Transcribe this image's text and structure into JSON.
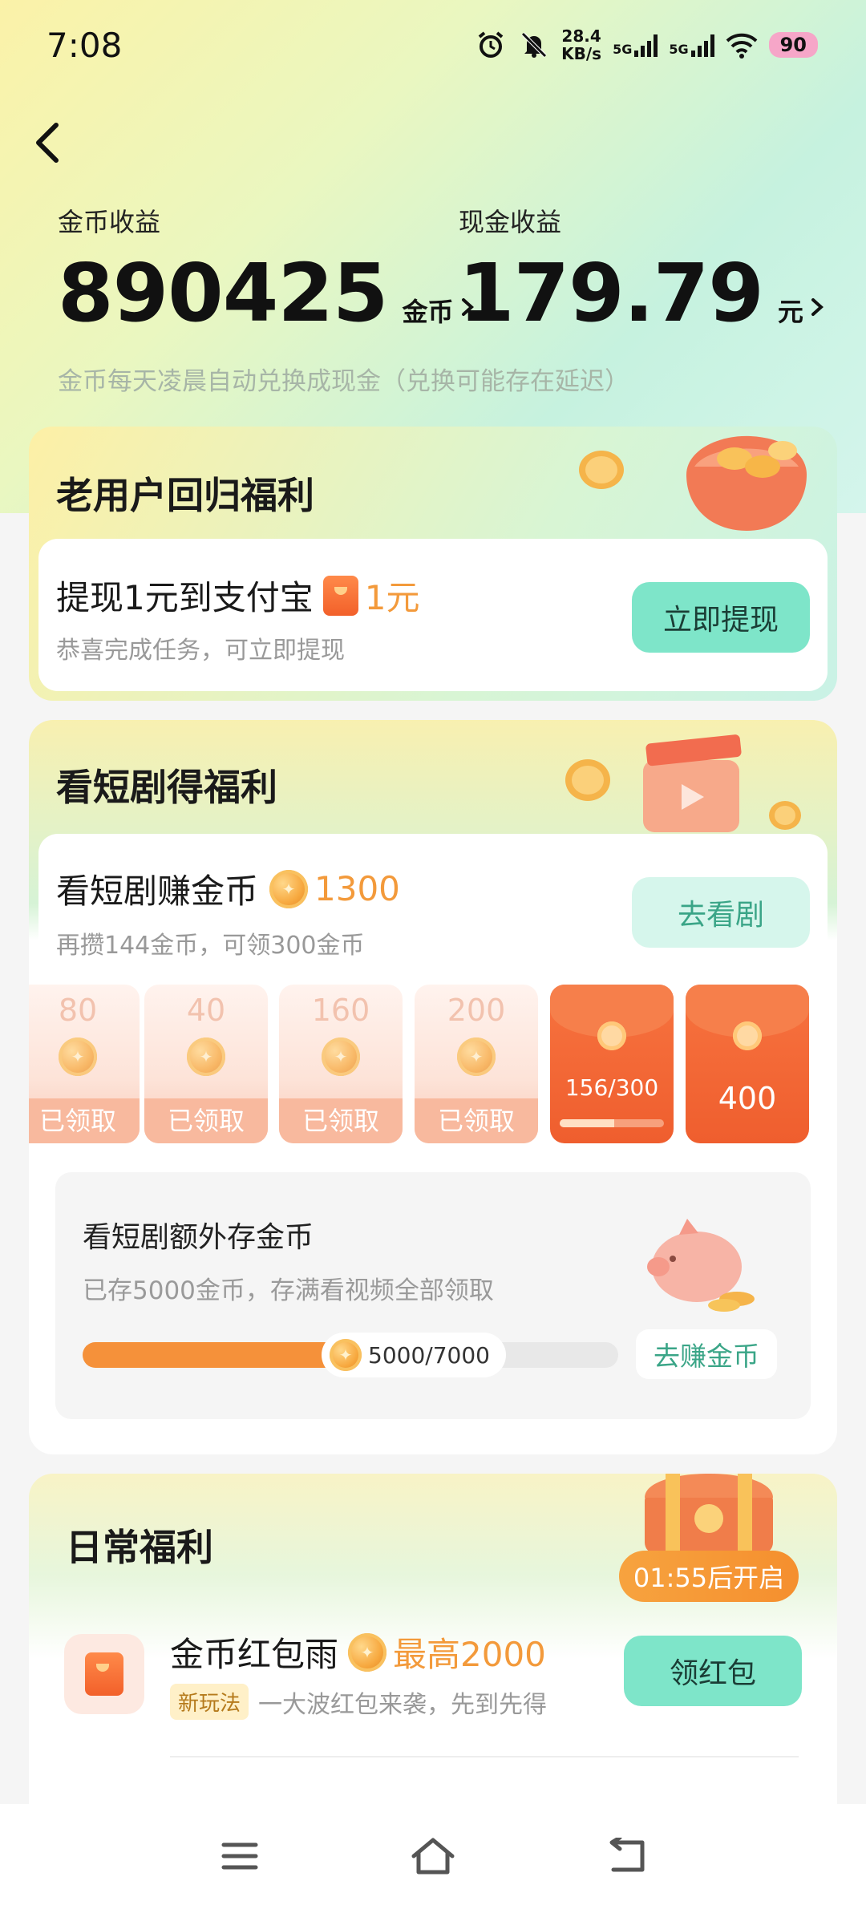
{
  "status_bar": {
    "time": "7:08",
    "net_speed_value": "28.4",
    "net_speed_unit": "KB/s",
    "signal1": "5G",
    "signal2": "5G",
    "battery": "90"
  },
  "earnings": {
    "coin_label": "金币收益",
    "coin_value": "890425",
    "coin_unit": "金币",
    "cash_label": "现金收益",
    "cash_value": "179.79",
    "cash_unit": "元",
    "note": "金币每天凌晨自动兑换成现金（兑换可能存在延迟）"
  },
  "returning_user": {
    "title": "老用户回归福利",
    "row_title": "提现1元到支付宝",
    "row_amount": "1元",
    "row_sub": "恭喜完成任务，可立即提现",
    "button": "立即提现"
  },
  "drama": {
    "title": "看短剧得福利",
    "row_title": "看短剧赚金币",
    "row_amount": "1300",
    "row_sub": "再攒144金币，可领300金币",
    "button": "去看剧",
    "claimed_label": "已领取",
    "tiers": [
      {
        "value": "80",
        "state": "claimed"
      },
      {
        "value": "40",
        "state": "claimed"
      },
      {
        "value": "160",
        "state": "claimed"
      },
      {
        "value": "200",
        "state": "claimed"
      },
      {
        "value": "156/300",
        "state": "in-progress",
        "progress": 0.52
      },
      {
        "value": "400",
        "state": "locked"
      }
    ],
    "extra": {
      "title": "看短剧额外存金币",
      "sub": "已存5000金币，存满看视频全部领取",
      "progress_text": "5000/7000",
      "progress": 0.714,
      "button": "去赚金币"
    }
  },
  "daily": {
    "title": "日常福利",
    "timer": "01:55后开启",
    "rain": {
      "title": "金币红包雨",
      "amount": "最高2000",
      "tag": "新玩法",
      "sub": "一大波红包来袭，先到先得",
      "button": "领红包"
    }
  },
  "colors": {
    "accent_green": "#7ee5c9",
    "accent_orange": "#f39a3b",
    "red_packet": "#ef5e2e"
  }
}
